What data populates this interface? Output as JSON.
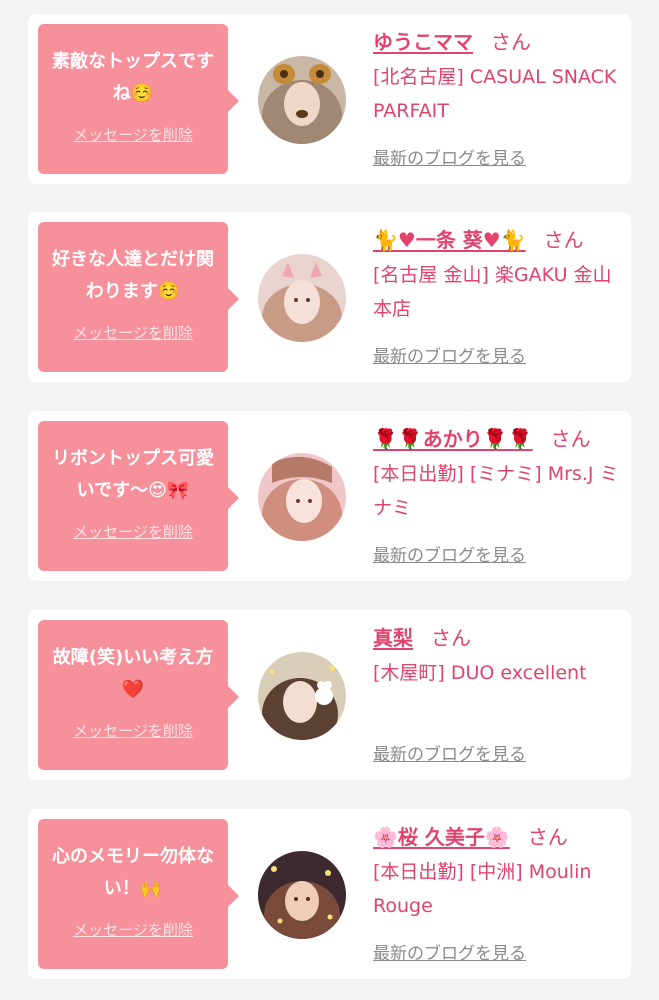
{
  "colors": {
    "bubble": "#f6909b",
    "accent": "#e2436e",
    "muted": "#8a8a8a",
    "background": "#f3f3f3"
  },
  "delete_label": "メッセージを削除",
  "blog_label": "最新のブログを見る",
  "honorific": "さん",
  "cards": [
    {
      "message": "素敵なトップスですね☺️",
      "name": "ゆうこママ",
      "shop": "[北名古屋] CASUAL SNACK PARFAIT"
    },
    {
      "message": "好きな人達とだけ関わります☺️",
      "name": "🐈♥一条 葵♥🐈",
      "shop": "[名古屋 金山] 楽GAKU 金山本店"
    },
    {
      "message": "リボントップス可愛いです〜😍🎀",
      "name": "🌹🌹あかり🌹🌹",
      "shop": "[本日出勤] [ミナミ] Mrs.J ミナミ"
    },
    {
      "message": "故障(笑)いい考え方❤️",
      "name": "真梨",
      "shop": "[木屋町] DUO excellent"
    },
    {
      "message": "心のメモリー勿体ない！🙌",
      "name": "🌸桜 久美子🌸",
      "shop": "[本日出勤] [中洲] Moulin Rouge"
    }
  ]
}
